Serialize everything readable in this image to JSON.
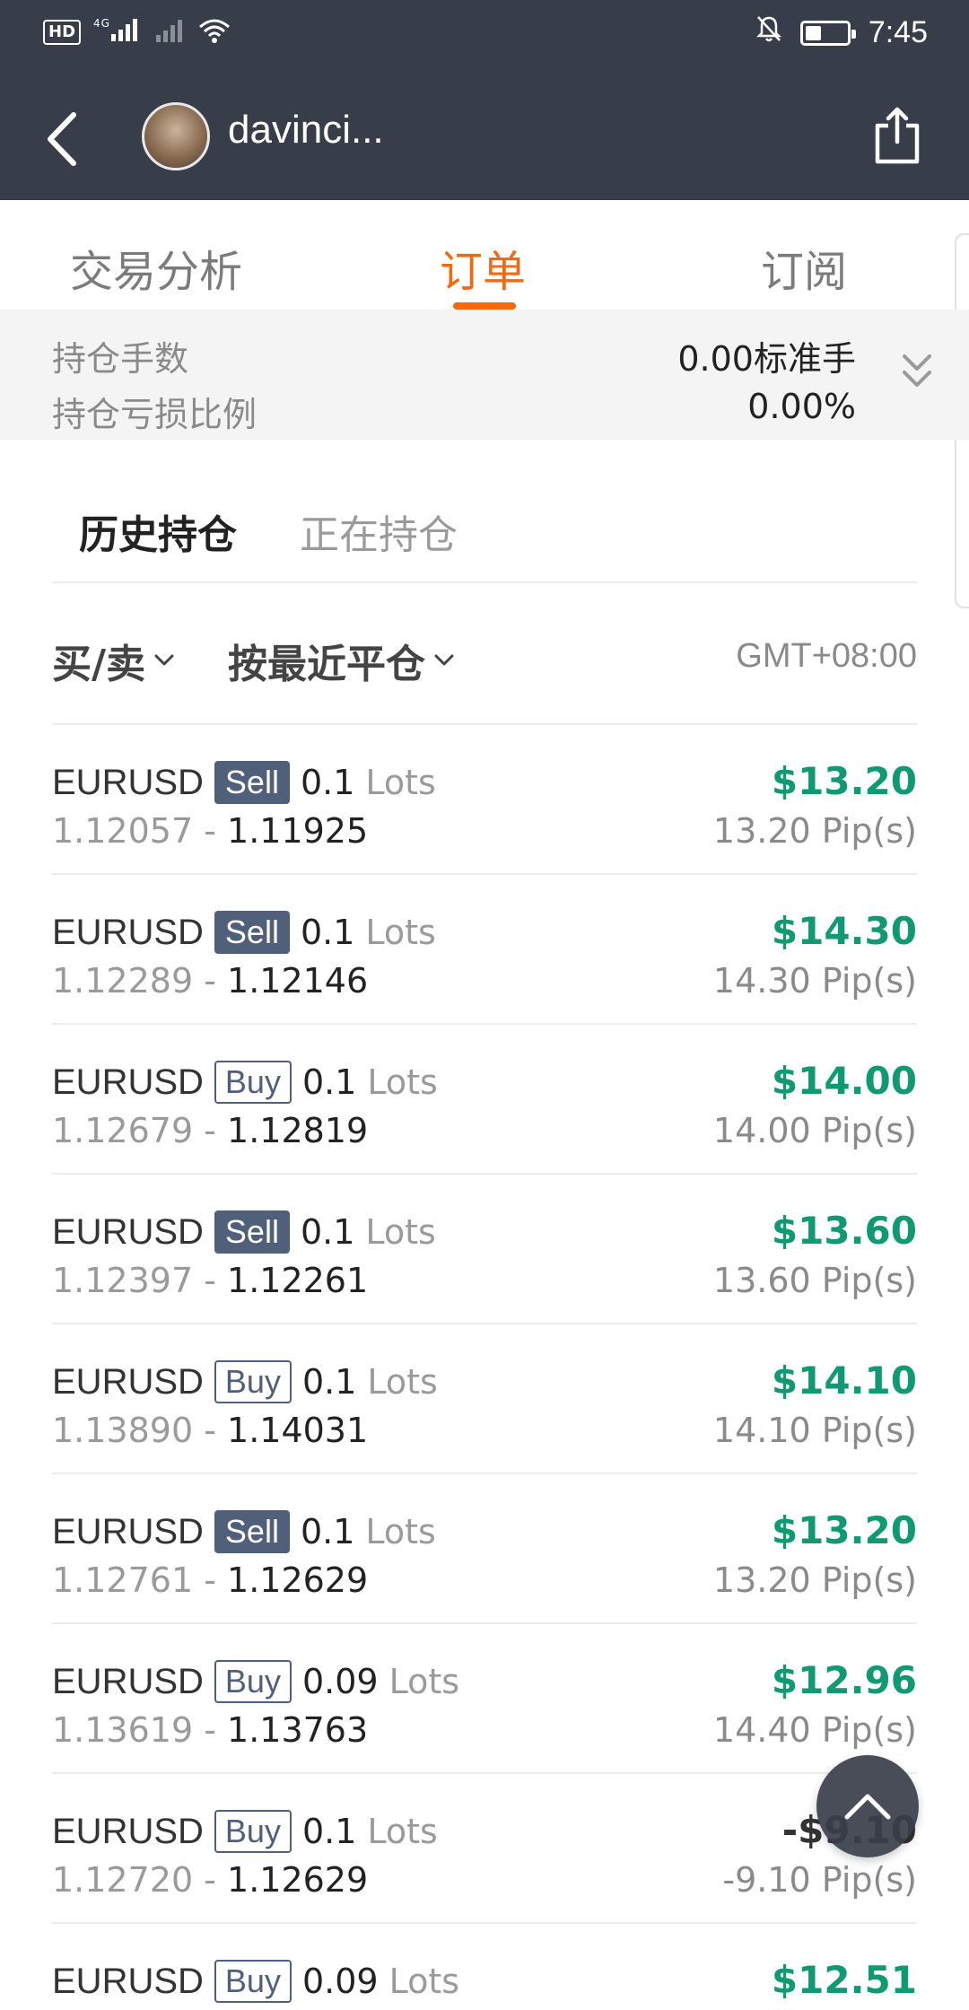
{
  "status_bar": {
    "hd": "HD",
    "signal1": "4G",
    "time": "7:45"
  },
  "nav": {
    "username": "davinci..."
  },
  "tabs": [
    {
      "label": "交易分析",
      "active": false
    },
    {
      "label": "订单",
      "active": true
    },
    {
      "label": "订阅",
      "active": false
    }
  ],
  "summary": {
    "lots_label": "持仓手数",
    "lots_value": "0.00标准手",
    "loss_label": "持仓亏损比例",
    "loss_value": "0.00%"
  },
  "subtabs": {
    "history": "历史持仓",
    "open": "正在持仓"
  },
  "filters": {
    "side": "买/卖",
    "sort": "按最近平仓",
    "timezone": "GMT+08:00"
  },
  "orders": [
    {
      "symbol": "EURUSD",
      "side": "Sell",
      "lots": "0.1",
      "lots_unit": "Lots",
      "open": "1.12057",
      "close": "1.11925",
      "profit": "$13.20",
      "pips": "13.20 Pip(s)"
    },
    {
      "symbol": "EURUSD",
      "side": "Sell",
      "lots": "0.1",
      "lots_unit": "Lots",
      "open": "1.12289",
      "close": "1.12146",
      "profit": "$14.30",
      "pips": "14.30 Pip(s)"
    },
    {
      "symbol": "EURUSD",
      "side": "Buy",
      "lots": "0.1",
      "lots_unit": "Lots",
      "open": "1.12679",
      "close": "1.12819",
      "profit": "$14.00",
      "pips": "14.00 Pip(s)"
    },
    {
      "symbol": "EURUSD",
      "side": "Sell",
      "lots": "0.1",
      "lots_unit": "Lots",
      "open": "1.12397",
      "close": "1.12261",
      "profit": "$13.60",
      "pips": "13.60 Pip(s)"
    },
    {
      "symbol": "EURUSD",
      "side": "Buy",
      "lots": "0.1",
      "lots_unit": "Lots",
      "open": "1.13890",
      "close": "1.14031",
      "profit": "$14.10",
      "pips": "14.10 Pip(s)"
    },
    {
      "symbol": "EURUSD",
      "side": "Sell",
      "lots": "0.1",
      "lots_unit": "Lots",
      "open": "1.12761",
      "close": "1.12629",
      "profit": "$13.20",
      "pips": "13.20 Pip(s)"
    },
    {
      "symbol": "EURUSD",
      "side": "Buy",
      "lots": "0.09",
      "lots_unit": "Lots",
      "open": "1.13619",
      "close": "1.13763",
      "profit": "$12.96",
      "pips": "14.40 Pip(s)"
    },
    {
      "symbol": "EURUSD",
      "side": "Buy",
      "lots": "0.1",
      "lots_unit": "Lots",
      "open": "1.12720",
      "close": "1.12629",
      "profit": "-$9.10",
      "pips": "-9.10 Pip(s)"
    },
    {
      "symbol": "EURUSD",
      "side": "Buy",
      "lots": "0.09",
      "lots_unit": "Lots",
      "open": "",
      "close": "",
      "profit": "$12.51",
      "pips": ""
    }
  ],
  "colors": {
    "header_bg": "#373e49",
    "accent": "#f26a0f",
    "profit": "#0f9a73",
    "side_badge": "#50607b"
  },
  "icons": {
    "back": "chevron-left-icon",
    "share": "share-icon",
    "expand": "double-chevron-down-icon",
    "scroll_top": "chevron-up-icon"
  }
}
